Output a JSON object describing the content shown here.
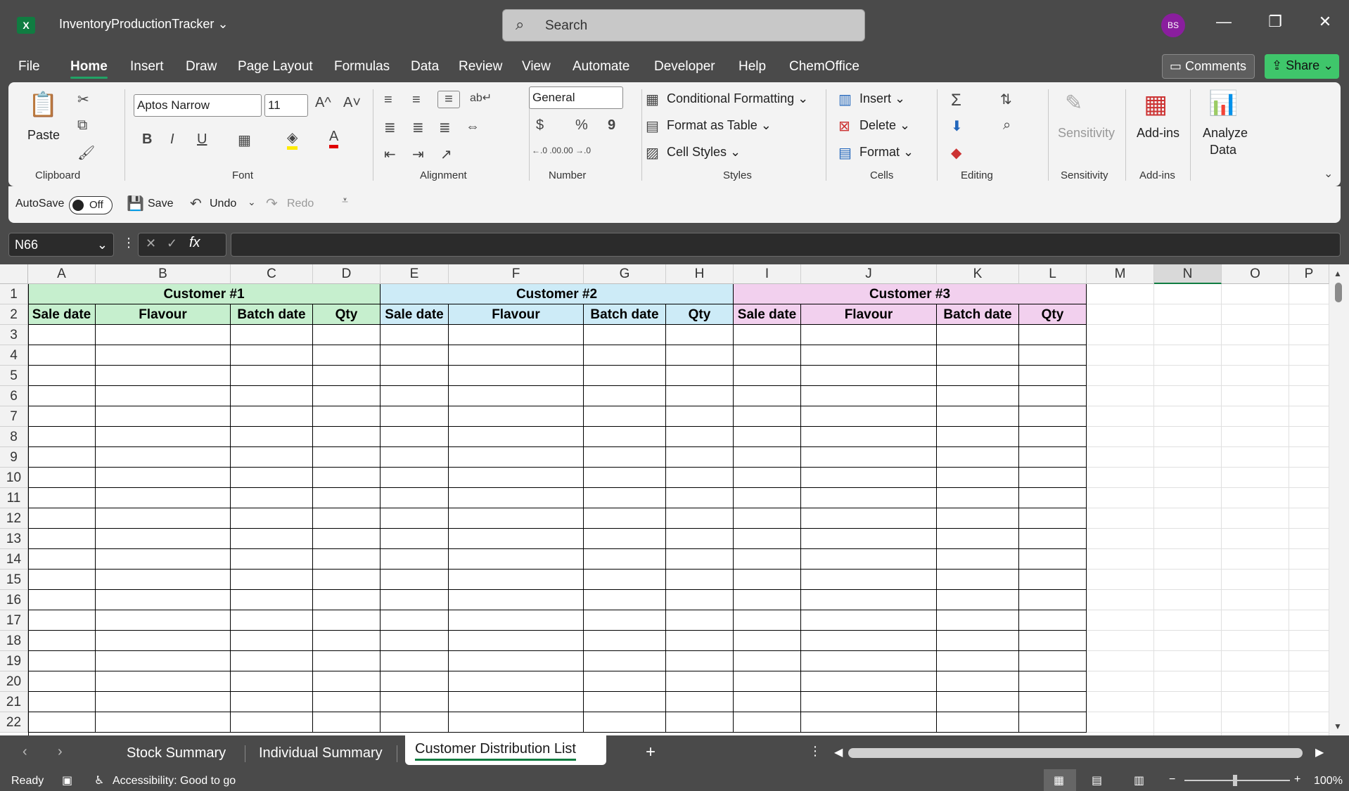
{
  "app": {
    "title": "InventoryProductionTracker",
    "search_placeholder": "Search",
    "avatar_initials": "BS",
    "logo": "X"
  },
  "window": {
    "minimize": "—",
    "restore": "❐",
    "close": "✕"
  },
  "menu": {
    "tabs": [
      "File",
      "Home",
      "Insert",
      "Draw",
      "Page Layout",
      "Formulas",
      "Data",
      "Review",
      "View",
      "Automate",
      "Developer",
      "Help",
      "ChemOffice"
    ],
    "active": "Home",
    "comments_label": "Comments",
    "share_label": "Share"
  },
  "ribbon": {
    "clipboard": {
      "paste": "Paste",
      "label": "Clipboard"
    },
    "font": {
      "name": "Aptos Narrow",
      "size": "11",
      "bold": "B",
      "italic": "I",
      "underline": "U",
      "label": "Font",
      "grow": "A^",
      "shrink": "A˅",
      "font_color": "A"
    },
    "alignment": {
      "label": "Alignment"
    },
    "number": {
      "format": "General",
      "label": "Number",
      "currency": "$",
      "percent": "%",
      "comma": "9",
      "inc_decimal": "←.0 .00",
      "dec_decimal": ".00 →.0"
    },
    "styles": {
      "conditional": "Conditional Formatting",
      "table": "Format as Table",
      "cell_styles": "Cell Styles",
      "label": "Styles"
    },
    "cells": {
      "insert": "Insert",
      "delete": "Delete",
      "format": "Format",
      "label": "Cells"
    },
    "editing": {
      "label": "Editing",
      "sum": "Σ"
    },
    "sensitivity": {
      "button": "Sensitivity",
      "label": "Sensitivity"
    },
    "addins": {
      "button": "Add-ins",
      "label": "Add-ins"
    },
    "analyze": {
      "line1": "Analyze",
      "line2": "Data"
    }
  },
  "qat": {
    "autosave": "AutoSave",
    "autosave_state": "Off",
    "save": "Save",
    "undo": "Undo",
    "redo": "Redo"
  },
  "formula_bar": {
    "name_box": "N66",
    "formula": "",
    "fx": "fx"
  },
  "columns": [
    "A",
    "B",
    "C",
    "D",
    "E",
    "F",
    "G",
    "H",
    "I",
    "J",
    "K",
    "L",
    "M",
    "N",
    "O",
    "P"
  ],
  "rows": [
    "1",
    "2",
    "3",
    "4",
    "5",
    "6",
    "7",
    "8",
    "9",
    "10",
    "11",
    "12",
    "13",
    "14",
    "15",
    "16",
    "17",
    "18",
    "19",
    "20",
    "21",
    "22"
  ],
  "customers": [
    {
      "title": "Customer #1",
      "color": "#c6efce"
    },
    {
      "title": "Customer #2",
      "color": "#cdebf7"
    },
    {
      "title": "Customer #3",
      "color": "#f2d0ee"
    }
  ],
  "headers": [
    "Sale date",
    "Flavour",
    "Batch date",
    "Qty"
  ],
  "sheets": [
    "Stock Summary",
    "Individual Summary",
    "Customer Distribution List"
  ],
  "active_sheet": "Customer Distribution List",
  "add_sheet": "+",
  "status": {
    "ready": "Ready",
    "accessibility": "Accessibility: Good to go",
    "zoom": "100%",
    "minus": "−",
    "plus": "+"
  },
  "colors": {
    "accent": "#21a366",
    "share_bg": "#3fc66b"
  }
}
